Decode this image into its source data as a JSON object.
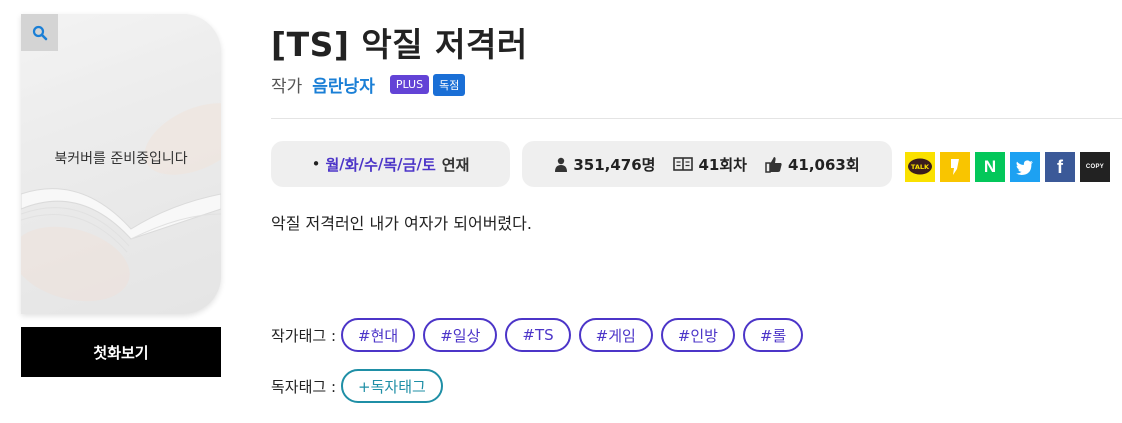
{
  "cover": {
    "placeholder_text": "북커버를 준비중입니다",
    "zoom_icon": "search-icon",
    "first_episode_label": "첫화보기"
  },
  "work": {
    "title": "[TS] 악질 저격러",
    "author_label": "작가",
    "author_name": "음란낭자",
    "badges": [
      "PLUS",
      "독점"
    ],
    "schedule": {
      "bullet": "•",
      "days": [
        "월",
        "화",
        "수",
        "목",
        "금",
        "토"
      ],
      "suffix": "연재"
    },
    "stats": {
      "views": "351,476명",
      "episodes": "41회차",
      "likes": "41,063회"
    },
    "share": {
      "items": [
        "kakaotalk-icon",
        "kakaostory-icon",
        "naver-icon",
        "twitter-icon",
        "facebook-icon",
        "copy-icon"
      ],
      "kakao_text": "TALK",
      "naver_text": "N",
      "facebook_text": "f",
      "copy_text": "COPY"
    },
    "description": "악질 저격러인 내가 여자가 되어버렸다.",
    "author_tags_label": "작가태그 :",
    "author_tags": [
      "#현대",
      "#일상",
      "#TS",
      "#게임",
      "#인방",
      "#롤"
    ],
    "reader_tags_label": "독자태그 :",
    "reader_tag_add": "+독자태그"
  },
  "colors": {
    "accent": "#4c35c8",
    "author_link": "#1a7fd6",
    "reader_tag": "#1f8fa6",
    "pill_bg": "#efefef"
  }
}
